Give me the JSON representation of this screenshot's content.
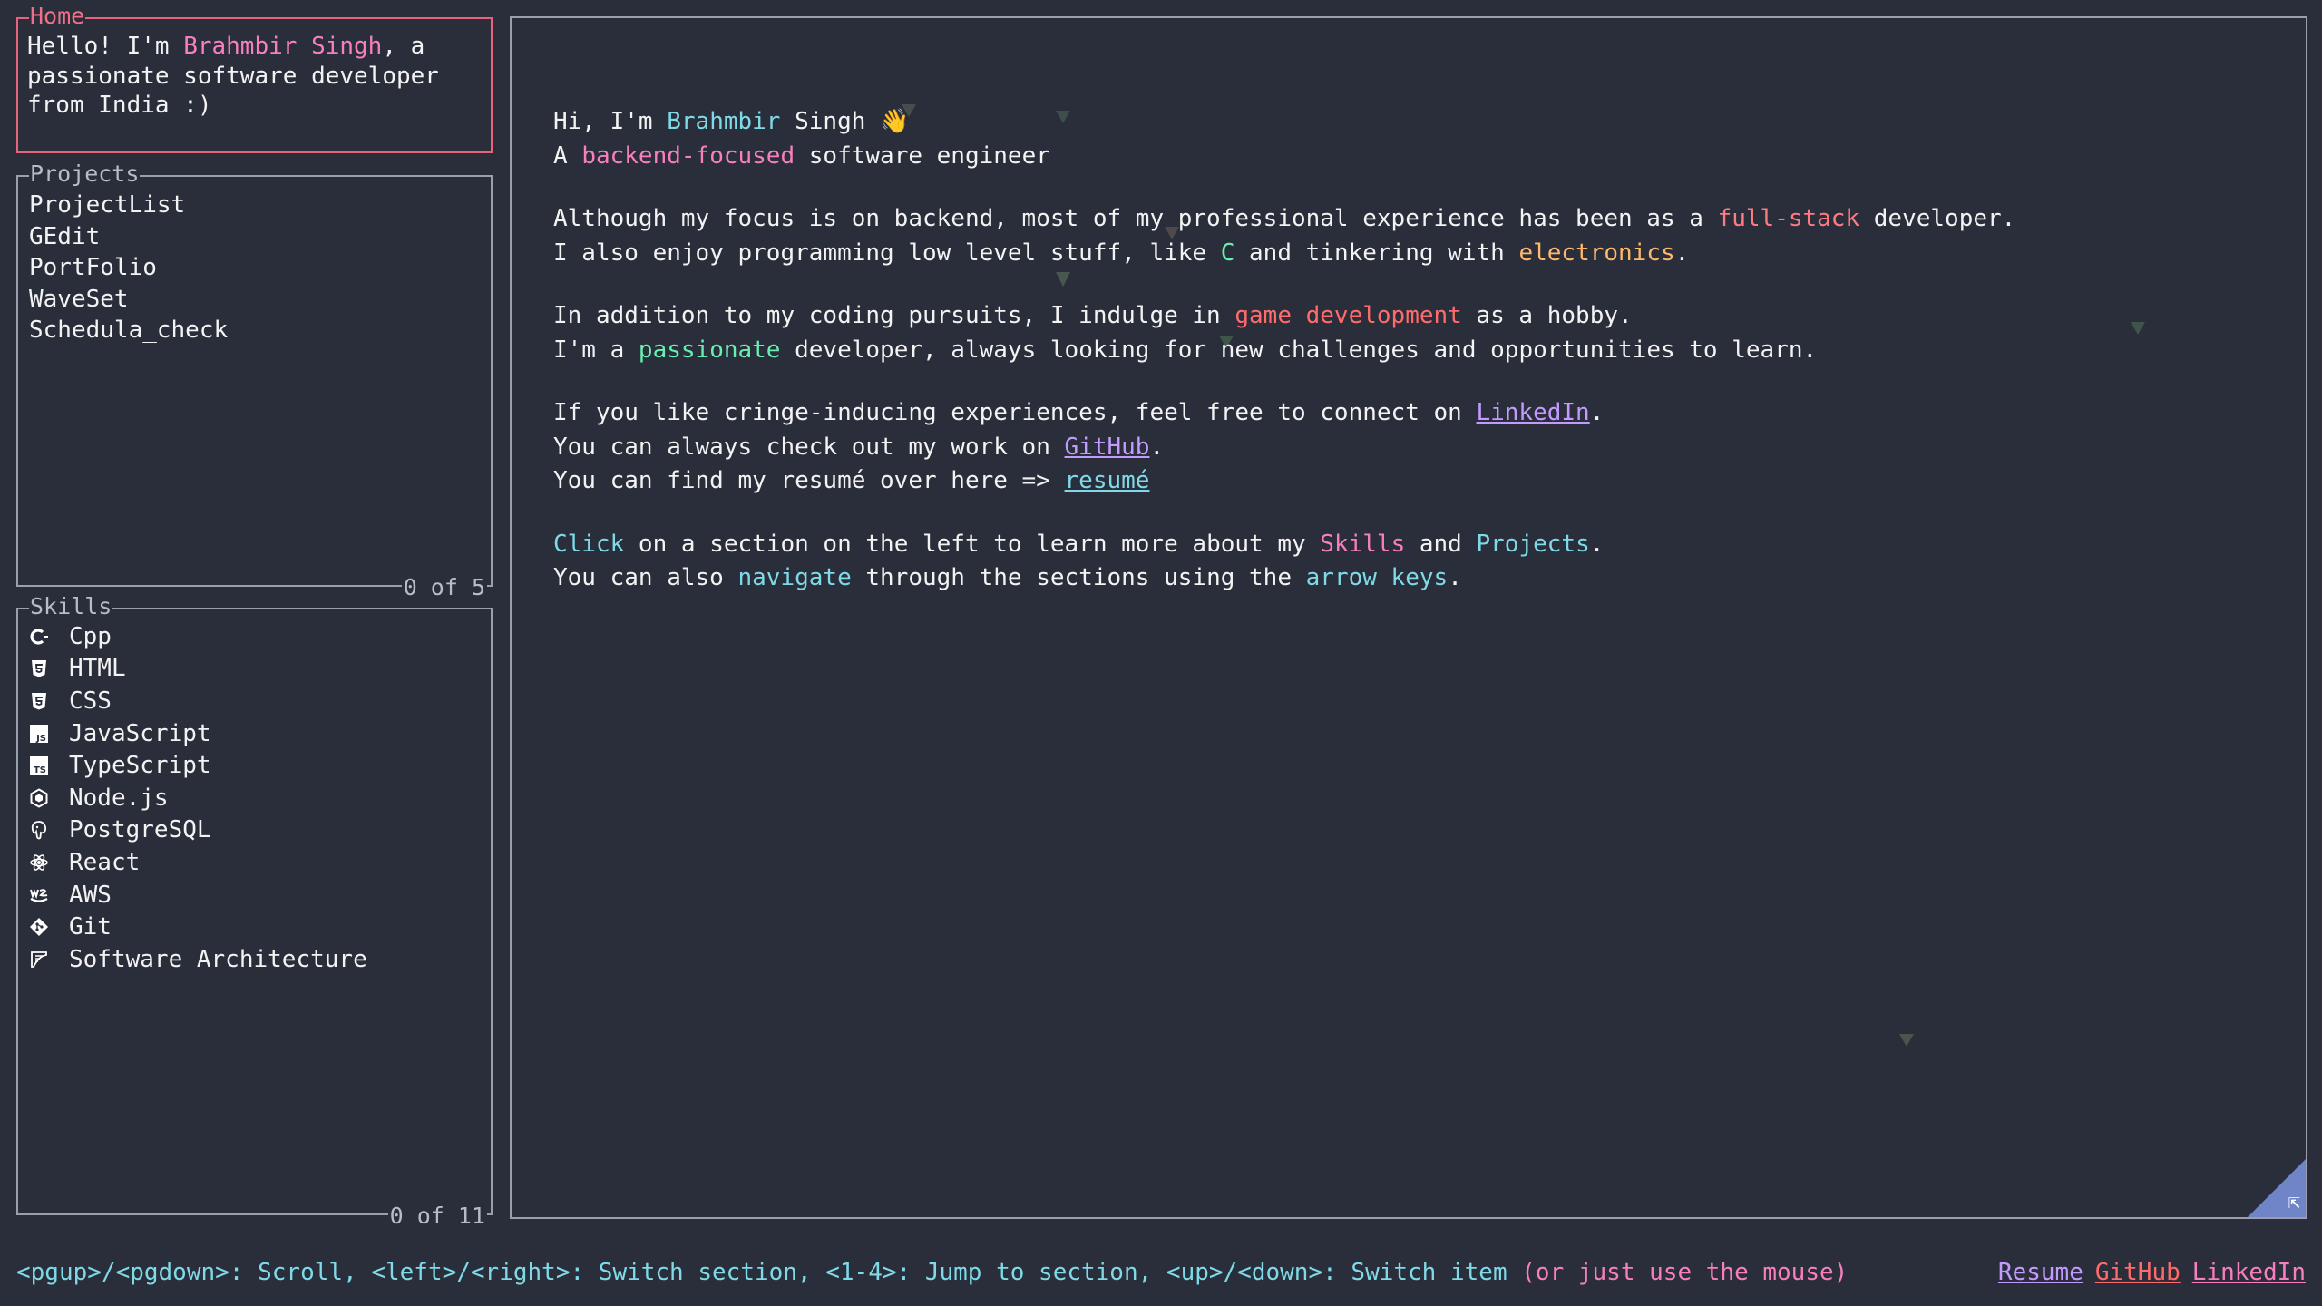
{
  "home": {
    "title": "Home",
    "intro_prefix": "Hello! I'm ",
    "intro_name": "Brahmbir Singh",
    "intro_suffix": ", a passionate software developer from India :)"
  },
  "projects": {
    "title": "Projects",
    "counter": "0 of 5",
    "items": [
      "ProjectList",
      "GEdit",
      "PortFolio",
      "WaveSet",
      "Schedula_check"
    ]
  },
  "skills": {
    "title": "Skills",
    "counter": "0 of 11",
    "items": [
      {
        "label": "Cpp",
        "icon": "cpp-icon"
      },
      {
        "label": "HTML",
        "icon": "html5-icon"
      },
      {
        "label": "CSS",
        "icon": "css3-icon"
      },
      {
        "label": "JavaScript",
        "icon": "javascript-icon"
      },
      {
        "label": "TypeScript",
        "icon": "typescript-icon"
      },
      {
        "label": "Node.js",
        "icon": "nodejs-icon"
      },
      {
        "label": "PostgreSQL",
        "icon": "postgresql-icon"
      },
      {
        "label": "React",
        "icon": "react-icon"
      },
      {
        "label": "AWS",
        "icon": "aws-icon"
      },
      {
        "label": "Git",
        "icon": "git-icon"
      },
      {
        "label": "Software Architecture",
        "icon": "architecture-icon"
      }
    ]
  },
  "main": {
    "greeting_prefix": "Hi, I'm ",
    "greeting_first": "Brahmbir",
    "greeting_last": " Singh ",
    "greeting_emoji": "👋",
    "tagline_a": "A ",
    "tagline_hl": "backend-focused",
    "tagline_rest": " software engineer",
    "p2_l1_a": "Although my focus is on backend, most of my professional experience has been as a ",
    "p2_l1_hl": "full-stack",
    "p2_l1_b": " developer.",
    "p2_l2_a": "I also enjoy programming low level stuff, like ",
    "p2_l2_c": "C",
    "p2_l2_b": " and tinkering with ",
    "p2_l2_hl": "electronics",
    "p2_l2_end": ".",
    "p3_l1_a": "In addition to my coding pursuits, I indulge in ",
    "p3_l1_hl": "game development",
    "p3_l1_b": " as a hobby.",
    "p3_l2_a": "I'm a ",
    "p3_l2_hl": "passionate",
    "p3_l2_b": " developer, always looking for new challenges and opportunities to learn.",
    "p4_l1_a": "If you like cringe-inducing experiences, feel free to connect on ",
    "p4_l1_link": "LinkedIn",
    "p4_l1_end": ".",
    "p4_l2_a": "You can always check out my work on ",
    "p4_l2_link": "GitHub",
    "p4_l2_end": ".",
    "p4_l3_a": "You can find my resumé over here => ",
    "p4_l3_link": "resumé",
    "p5_l1_click": "Click",
    "p5_l1_a": " on a section on the left to learn more about my ",
    "p5_l1_skills": "Skills",
    "p5_l1_and": " and ",
    "p5_l1_projects": "Projects",
    "p5_l1_end": ".",
    "p5_l2_a": "You can also ",
    "p5_l2_nav": "navigate",
    "p5_l2_b": " through the sections using the ",
    "p5_l2_keys": "arrow keys",
    "p5_l2_end": ".",
    "resize_icon": "⇱"
  },
  "footer": {
    "help": "<pgup>/<pgdown>: Scroll, <left>/<right>: Switch section, <1-4>: Jump to section, <up>/<down>: Switch item ",
    "help_muted": "(or just use the mouse)",
    "links": [
      "Resume",
      "GitHub",
      "LinkedIn"
    ]
  },
  "colors": {
    "background": "#292e3a",
    "accent_pink": "#f77fbe",
    "accent_cyan": "#7fd9e6",
    "accent_red": "#ff6b6b",
    "home_border": "#e8637a",
    "corner": "#7084c8"
  }
}
